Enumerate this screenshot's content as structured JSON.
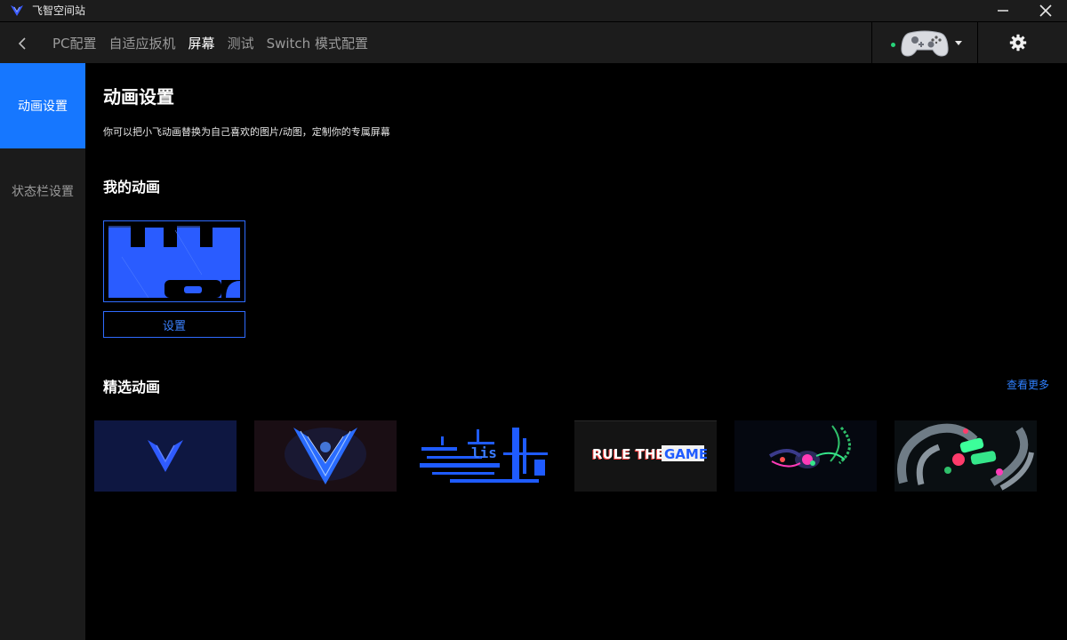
{
  "app": {
    "title": "飞智空间站"
  },
  "nav": {
    "tabs": [
      {
        "label": "PC配置"
      },
      {
        "label": "自适应扳机"
      },
      {
        "label": "屏幕"
      },
      {
        "label": "测试"
      },
      {
        "label": "Switch 模式配置"
      }
    ]
  },
  "sidebar": {
    "items": [
      {
        "label": "动画设置"
      },
      {
        "label": "状态栏设置"
      }
    ]
  },
  "main": {
    "title": "动画设置",
    "description": "你可以把小飞动画替换为自己喜欢的图片/动图，定制你的专属屏幕",
    "my_animation": {
      "heading": "我的动画",
      "set_button_label": "设置"
    },
    "featured": {
      "heading": "精选动画",
      "view_more_label": "查看更多",
      "thumbnail_text": {
        "rule": "RULE THE",
        "game": "GAME"
      }
    }
  },
  "colors": {
    "accent": "#1677ff",
    "link": "#2f80ff",
    "status_online": "#27d37a"
  }
}
